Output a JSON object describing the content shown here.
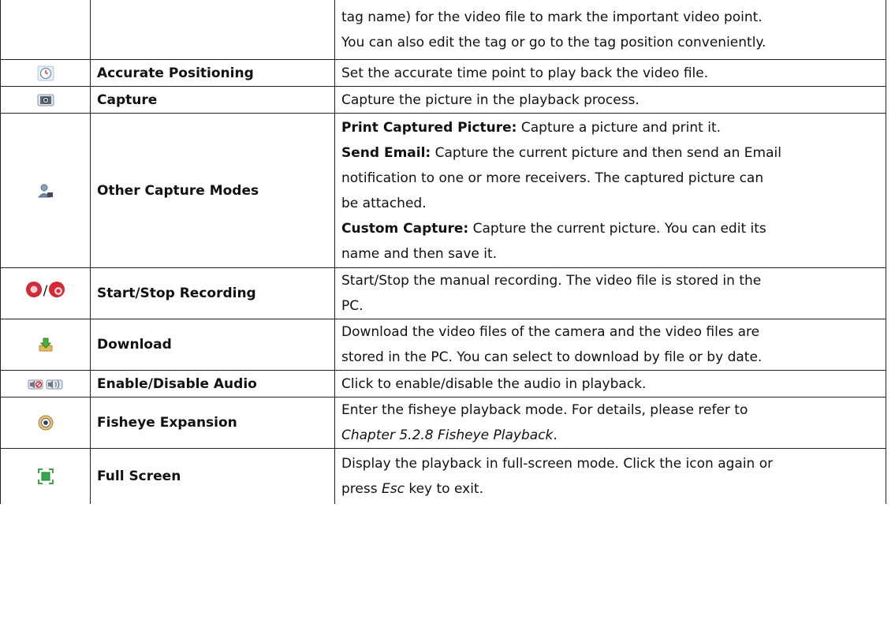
{
  "rows": [
    {
      "icon": "",
      "name": "",
      "desc_lines": [
        "tag name) for the video file to mark the important video point.",
        "You can also edit the tag or go to the tag position conveniently."
      ]
    },
    {
      "icon": "clock-icon",
      "name": "Accurate Positioning",
      "desc_lines": [
        "Set the accurate time point to play back the video file."
      ]
    },
    {
      "icon": "camera-icon",
      "name": "Capture",
      "desc_lines": [
        "Capture the picture in the playback process."
      ]
    },
    {
      "icon": "user-capture-icon",
      "name": "Other Capture Modes",
      "items": [
        {
          "term": "Print Captured Picture:",
          "text": " Capture a picture and print it."
        },
        {
          "term": "Send Email:",
          "text": " Capture the current picture and then send an Email"
        },
        {
          "term": "",
          "text": "notification to one or more receivers. The captured picture can"
        },
        {
          "term": "",
          "text": "be attached."
        },
        {
          "term": "Custom Capture:",
          "text": " Capture the current picture. You can edit its"
        },
        {
          "term": "",
          "text": "name and then save it."
        }
      ]
    },
    {
      "icon": "record-start-stop-icon",
      "icon_separator": "/",
      "name": "Start/Stop Recording",
      "desc_lines": [
        "Start/Stop the manual recording. The video file is stored in the",
        "PC."
      ]
    },
    {
      "icon": "download-icon",
      "name": "Download",
      "desc_lines": [
        "Download the video files of the camera and the video files are",
        "stored in the PC. You can select to download by file or by date."
      ]
    },
    {
      "icon": "audio-toggle-icon",
      "name": "Enable/Disable Audio",
      "desc_lines": [
        "Click to enable/disable the audio in playback."
      ]
    },
    {
      "icon": "fisheye-icon",
      "name": "Fisheye Expansion",
      "desc_line1": "Enter the fisheye playback mode. For details, please refer to",
      "desc_ref": "Chapter 5.2.8 Fisheye Playback",
      "desc_ref_end": "."
    },
    {
      "icon": "fullscreen-icon",
      "name": "Full Screen",
      "desc_line1": "Display the playback in full-screen mode. Click the icon again or",
      "desc_pre": "press ",
      "desc_key": "Esc",
      "desc_post": " key to exit."
    }
  ],
  "colors": {
    "border": "#222222",
    "record_red": "#d42a35",
    "download_green": "#4caf3c",
    "fullscreen_green": "#3aa84a"
  }
}
